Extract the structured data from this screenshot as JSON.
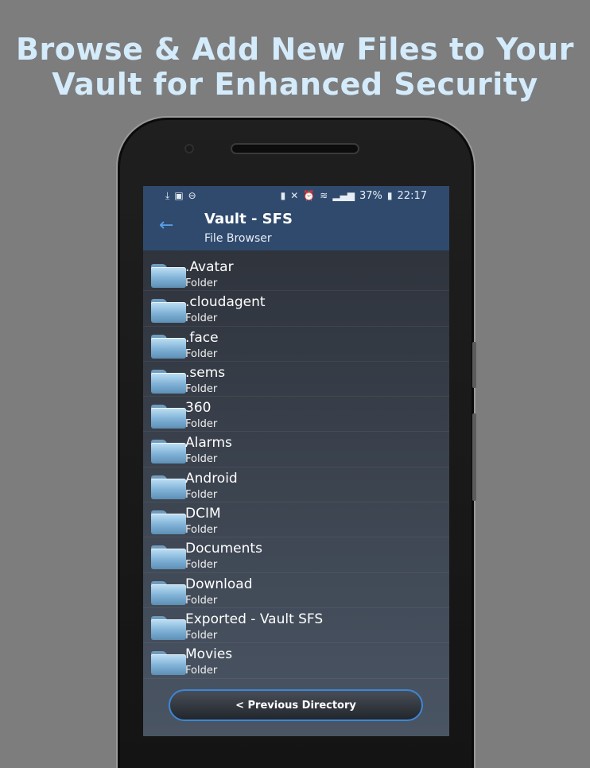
{
  "headline": {
    "line1": "Browse & Add New Files to Your",
    "line2": "Vault for Enhanced Security"
  },
  "colors": {
    "background": "#7d7d7d",
    "headline": "#d4ebfb",
    "appbar": "#304a6e",
    "accent": "#3d86d6"
  },
  "statusbar": {
    "left_icons": [
      "download-icon",
      "image-icon",
      "dnd-icon"
    ],
    "right_icons": [
      "battery-saver-icon",
      "mute-icon",
      "alarm-icon",
      "wifi-icon",
      "signal-icon"
    ],
    "battery": "37%",
    "time": "22:17"
  },
  "toolbar": {
    "title": "Vault - SFS",
    "subtitle": "File Browser",
    "back_icon": "arrow-back-icon"
  },
  "files": [
    {
      "name": ".Avatar",
      "type": "Folder"
    },
    {
      "name": ".cloudagent",
      "type": "Folder"
    },
    {
      "name": ".face",
      "type": "Folder"
    },
    {
      "name": ".sems",
      "type": "Folder"
    },
    {
      "name": "360",
      "type": "Folder"
    },
    {
      "name": "Alarms",
      "type": "Folder"
    },
    {
      "name": "Android",
      "type": "Folder"
    },
    {
      "name": "DCIM",
      "type": "Folder"
    },
    {
      "name": "Documents",
      "type": "Folder"
    },
    {
      "name": "Download",
      "type": "Folder"
    },
    {
      "name": "Exported - Vault SFS",
      "type": "Folder"
    },
    {
      "name": "Movies",
      "type": "Folder"
    }
  ],
  "footer": {
    "previous_label": "< Previous Directory"
  }
}
